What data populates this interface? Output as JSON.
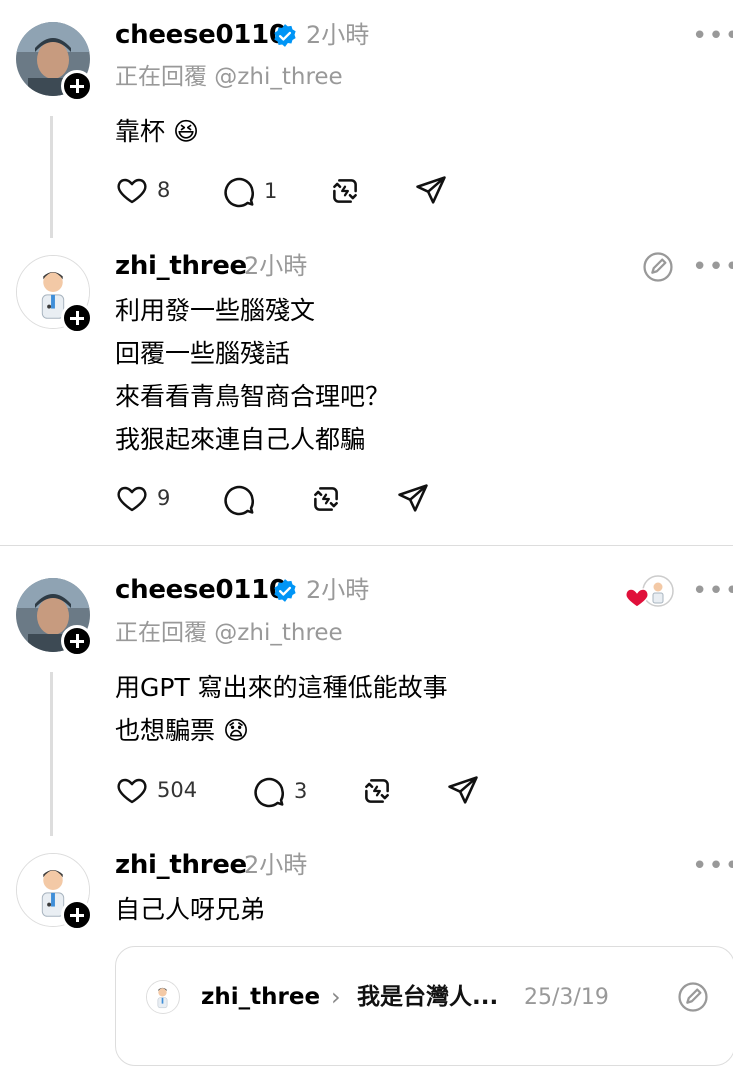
{
  "posts": [
    {
      "username": "cheese0110",
      "time": "2小時",
      "reply_to": "正在回覆 @zhi_three",
      "body": [
        "靠杯 😆"
      ],
      "likes": "8",
      "comments": "1"
    },
    {
      "username": "zhi_three",
      "time": "2小時",
      "body": [
        "利用發一些腦殘文",
        "回覆一些腦殘話",
        "來看看青鳥智商合理吧？",
        "我狠起來連自己人都騙"
      ],
      "likes": "9"
    },
    {
      "username": "cheese0110",
      "time": "2小時",
      "reply_to": "正在回覆 @zhi_three",
      "body": [
        "用GPT 寫出來的這種低能故事",
        "也想騙票 😧"
      ],
      "likes": "504",
      "comments": "3"
    },
    {
      "username": "zhi_three",
      "time": "2小時",
      "body": [
        "自己人呀兄弟"
      ]
    }
  ],
  "quote": {
    "username": "zhi_three",
    "title": "我是台灣人...",
    "date": "25/3/19"
  },
  "colors": {
    "verified": "#0095F6",
    "liked_heart": "#E0103A",
    "muted": "#999999"
  },
  "icons": [
    "heart-icon",
    "comment-icon",
    "repost-icon",
    "share-icon",
    "verified-badge-icon",
    "more-icon",
    "quote-edit-icon"
  ]
}
